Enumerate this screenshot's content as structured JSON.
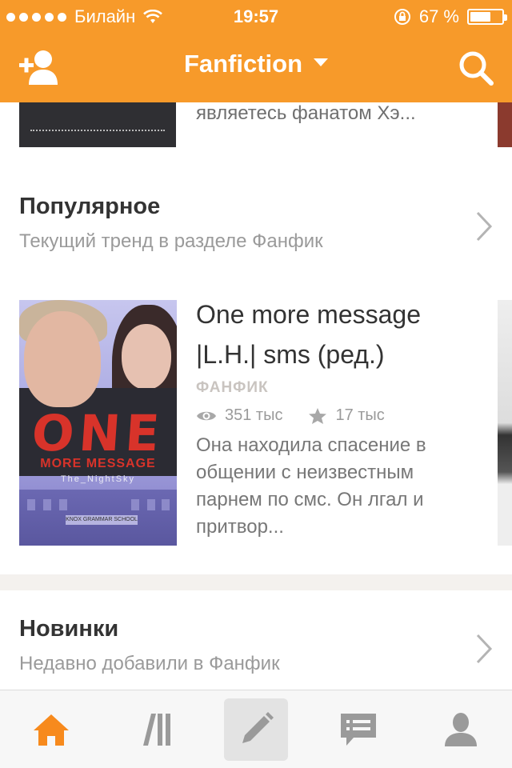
{
  "status_bar": {
    "carrier": "Билайн",
    "time": "19:57",
    "battery": "67 %",
    "battery_level": 0.67
  },
  "header": {
    "title": "Fanfiction",
    "left_icon": "add-user-icon",
    "right_icon": "search-icon"
  },
  "previous_item": {
    "description_tail": "являетесь фанатом Хэ..."
  },
  "popular": {
    "title": "Популярное",
    "subtitle": "Текущий тренд в разделе Фанфик",
    "book": {
      "cover_title": "ONE",
      "cover_subtitle": "MORE MESSAGE",
      "cover_author": "The_NightSky",
      "title": "One more message |L.H.| sms (ред.)",
      "category": "ФАНФИК",
      "views": "351 тыс",
      "votes": "17 тыс",
      "description": "Она находила спасение в общении с неизвестным парнем по смс. Он лгал и притвор..."
    }
  },
  "new_section": {
    "title": "Новинки",
    "subtitle": "Недавно добавили в Фанфик"
  },
  "tabbar": {
    "items": [
      "home-icon",
      "library-icon",
      "write-icon",
      "messages-icon",
      "profile-icon"
    ],
    "active": "home-icon"
  },
  "colors": {
    "brand_orange": "#f79a2a",
    "active_tab": "#f78a1d",
    "inactive_tab": "#9a9a9a"
  }
}
